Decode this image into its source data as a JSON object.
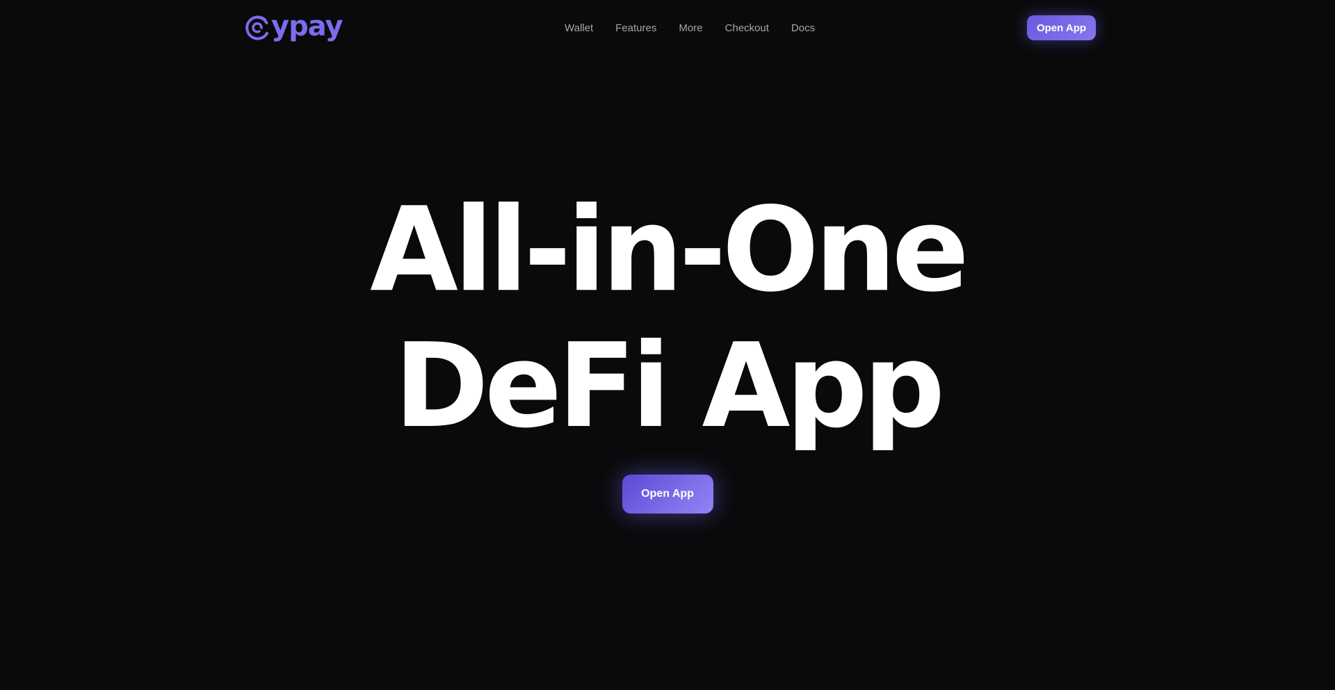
{
  "brand": {
    "name": "ypay",
    "logo_icon": "c-swirl-icon",
    "color": "#7b6cf0"
  },
  "nav": {
    "items": [
      {
        "label": "Wallet"
      },
      {
        "label": "Features"
      },
      {
        "label": "More"
      },
      {
        "label": "Checkout"
      },
      {
        "label": "Docs"
      }
    ]
  },
  "header": {
    "cta_label": "Open App"
  },
  "hero": {
    "title_line_1": "All-in-One",
    "title_line_2": "DeFi App",
    "cta_label": "Open App"
  },
  "colors": {
    "background": "#0a0a0b",
    "accent": "#6a5ae0",
    "accent_light": "#9b8ff7",
    "nav_text": "#a7a7ad"
  }
}
